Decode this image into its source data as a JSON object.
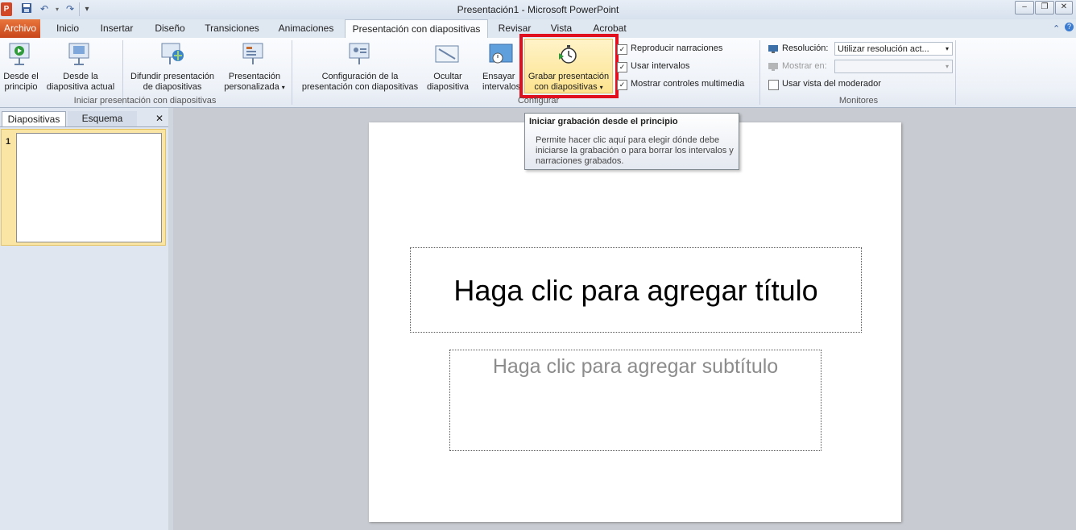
{
  "window": {
    "title": "Presentación1 - Microsoft PowerPoint",
    "minimize_label": "–",
    "restore_label": "❐",
    "close_label": "✕"
  },
  "qat": {
    "app_icon": "P",
    "save_icon": "save-icon",
    "undo_icon": "undo-icon",
    "redo_icon": "redo-icon",
    "customize_icon": "customize-icon"
  },
  "tabs": [
    {
      "label": "Archivo"
    },
    {
      "label": "Inicio"
    },
    {
      "label": "Insertar"
    },
    {
      "label": "Diseño"
    },
    {
      "label": "Transiciones"
    },
    {
      "label": "Animaciones"
    },
    {
      "label": "Presentación con diapositivas"
    },
    {
      "label": "Revisar"
    },
    {
      "label": "Vista"
    },
    {
      "label": "Acrobat"
    }
  ],
  "ribbon": {
    "groups": {
      "start": "Iniciar presentación con diapositivas",
      "config": "Configurar",
      "monitors": "Monitores"
    },
    "buttons": {
      "desde_principio_1": "Desde el",
      "desde_principio_2": "principio",
      "desde_actual_1": "Desde la",
      "desde_actual_2": "diapositiva actual",
      "difundir_1": "Difundir presentación",
      "difundir_2": "de diapositivas",
      "personalizada_1": "Presentación",
      "personalizada_2": "personalizada",
      "configuracion_1": "Configuración de la",
      "configuracion_2": "presentación con diapositivas",
      "ocultar_1": "Ocultar",
      "ocultar_2": "diapositiva",
      "ensayar_1": "Ensayar",
      "ensayar_2": "intervalos",
      "grabar_1": "Grabar presentación",
      "grabar_2": "con diapositivas"
    },
    "checks": {
      "reproducir": "Reproducir narraciones",
      "usar_intervalos": "Usar intervalos",
      "mostrar_controles": "Mostrar controles multimedia",
      "vista_moderador": "Usar vista del moderador"
    },
    "monitors": {
      "resolucion_label": "Resolución:",
      "resolucion_value": "Utilizar resolución act...",
      "mostrar_en_label": "Mostrar en:",
      "mostrar_en_value": ""
    }
  },
  "left_panel": {
    "tab_slides": "Diapositivas",
    "tab_outline": "Esquema",
    "close": "✕",
    "slide_number": "1"
  },
  "slide": {
    "title_placeholder": "Haga clic para agregar título",
    "subtitle_placeholder": "Haga clic para agregar subtítulo"
  },
  "tooltip": {
    "title": "Iniciar grabación desde el principio",
    "body": "Permite hacer clic aquí para elegir dónde debe iniciarse la grabación o para borrar los intervalos y narraciones grabados."
  },
  "colors": {
    "archivo_tab": "#c8461b",
    "highlight": "#e0101e",
    "selected_thumb": "#fbe5a4"
  }
}
